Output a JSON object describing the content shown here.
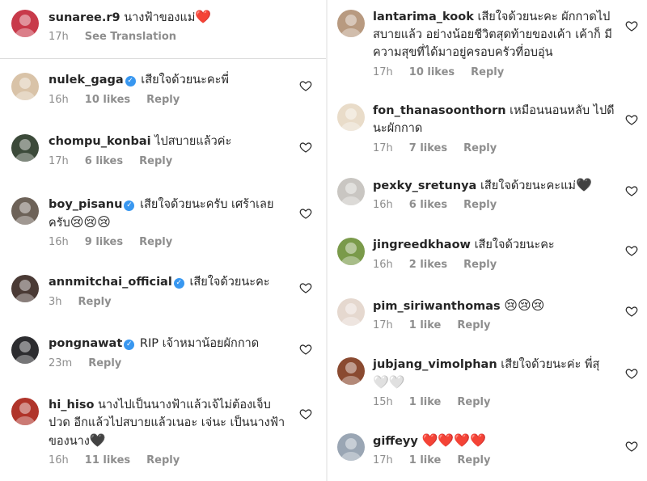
{
  "left": [
    {
      "user": "sunaree.r9",
      "verified": false,
      "text": "นางฟ้าของแม่",
      "emoji": "❤️",
      "time": "17h",
      "likes": "",
      "action": "See Translation",
      "avatar": "#c83a4a",
      "heart": false
    },
    {
      "user": "nulek_gaga",
      "verified": true,
      "text": "เสียใจด้วยนะคะพี่",
      "emoji": "",
      "time": "16h",
      "likes": "10 likes",
      "action": "Reply",
      "avatar": "#d9c3a8",
      "heart": true
    },
    {
      "user": "chompu_konbai",
      "verified": false,
      "text": "ไปสบายแล้วค่ะ",
      "emoji": "",
      "time": "17h",
      "likes": "6 likes",
      "action": "Reply",
      "avatar": "#3c4a3a",
      "heart": true
    },
    {
      "user": "boy_pisanu",
      "verified": true,
      "text": "เสียใจด้วยนะครับ เศร้าเลย ครับ",
      "emoji": "😢😢😢",
      "time": "16h",
      "likes": "9 likes",
      "action": "Reply",
      "avatar": "#6d6258",
      "heart": true
    },
    {
      "user": "annmitchai_official",
      "verified": true,
      "text": "เสียใจด้วยนะคะ",
      "emoji": "",
      "time": "3h",
      "likes": "",
      "action": "Reply",
      "avatar": "#4a3a35",
      "heart": true
    },
    {
      "user": "pongnawat",
      "verified": true,
      "text": "RIP เจ้าหมาน้อยผักกาด",
      "emoji": "",
      "time": "23m",
      "likes": "",
      "action": "Reply",
      "avatar": "#2d2d30",
      "heart": true
    },
    {
      "user": "hi_hiso",
      "verified": false,
      "text": "นางไปเป็นนางฟ้าแล้วเจ้ไม่ต้องเจ็บ ปวด อีกแล้วไปสบายแล้วเนอะ เจ่นะ เป็นนางฟ้า ของนาง",
      "emoji": "🖤",
      "time": "16h",
      "likes": "11 likes",
      "action": "Reply",
      "avatar": "#b0342a",
      "heart": true
    }
  ],
  "right": [
    {
      "user": "lantarima_kook",
      "verified": false,
      "text": "เสียใจด้วยนะคะ ผักกาดไป สบายแล้ว อย่างน้อยชีวิตสุดท้ายของเค้า เค้าก็ มีความสุขที่ได้มาอยู่ครอบครัวที่อบอุ่น",
      "emoji": "",
      "time": "17h",
      "likes": "10 likes",
      "action": "Reply",
      "avatar": "#b89a80",
      "heart": true
    },
    {
      "user": "fon_thanasoonthorn",
      "verified": false,
      "text": "เหมือนนอนหลับ ไปดี นะผักกาด",
      "emoji": "",
      "time": "17h",
      "likes": "7 likes",
      "action": "Reply",
      "avatar": "#e9dcc9",
      "heart": true
    },
    {
      "user": "pexky_sretunya",
      "verified": false,
      "text": "เสียใจด้วยนะคะแม่",
      "emoji": "🖤",
      "time": "16h",
      "likes": "6 likes",
      "action": "Reply",
      "avatar": "#c9c6c2",
      "heart": true
    },
    {
      "user": "jingreedkhaow",
      "verified": false,
      "text": "เสียใจด้วยนะคะ",
      "emoji": "",
      "time": "16h",
      "likes": "2 likes",
      "action": "Reply",
      "avatar": "#7a9a4a",
      "heart": true
    },
    {
      "user": "pim_siriwanthomas",
      "verified": false,
      "text": "",
      "emoji": "😢😢😢",
      "time": "17h",
      "likes": "1 like",
      "action": "Reply",
      "avatar": "#e5d8cf",
      "heart": true
    },
    {
      "user": "jubjang_vimolphan",
      "verified": false,
      "text": "เสียใจด้วยนะค่ะ พี่สุ",
      "emoji": "🤍🤍",
      "time": "15h",
      "likes": "1 like",
      "action": "Reply",
      "avatar": "#8a4a30",
      "heart": true
    },
    {
      "user": "giffeyy",
      "verified": false,
      "text": "",
      "emoji": "❤️❤️❤️❤️",
      "time": "17h",
      "likes": "1 like",
      "action": "Reply",
      "avatar": "#9aa6b4",
      "heart": true
    }
  ]
}
